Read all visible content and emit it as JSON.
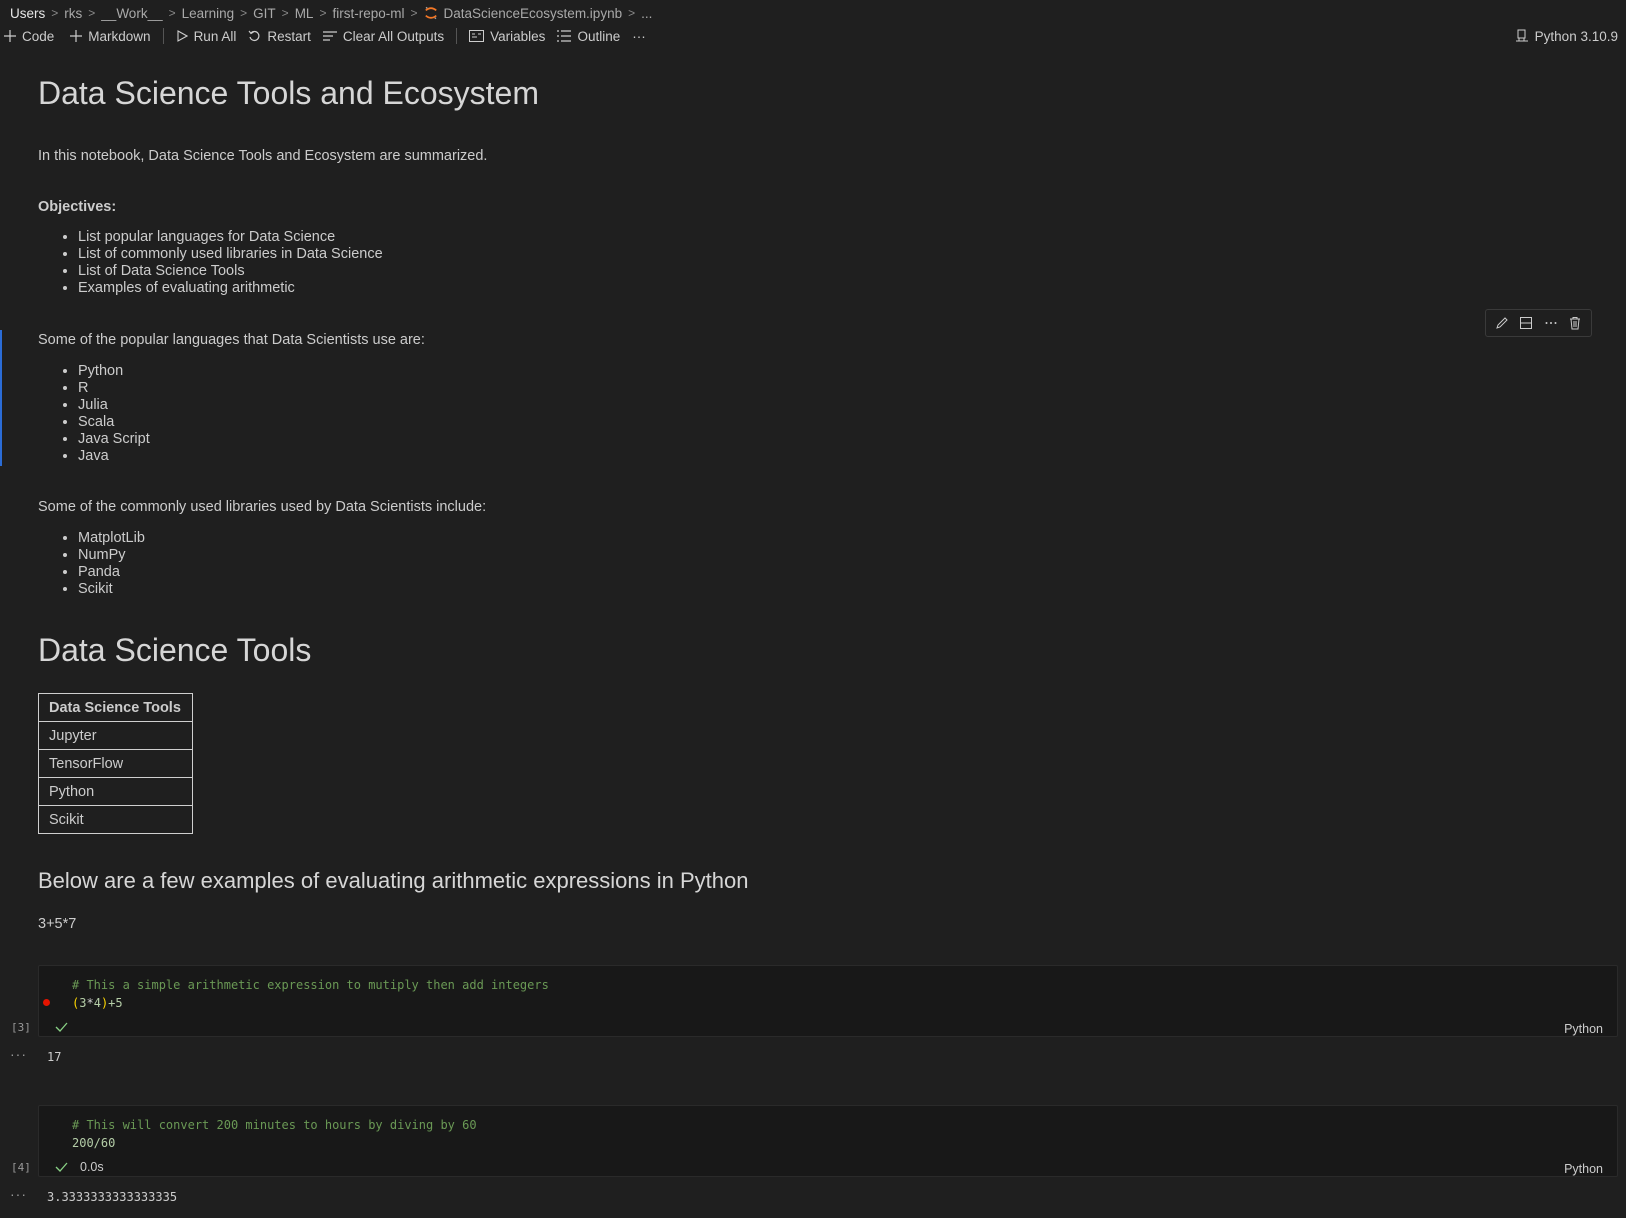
{
  "breadcrumb": {
    "items": [
      "Users",
      "rks",
      "__Work__",
      "Learning",
      "GIT",
      "ML",
      "first-repo-ml"
    ],
    "file": "DataScienceEcosystem.ipynb",
    "more": "..."
  },
  "toolbar": {
    "code": "Code",
    "markdown": "Markdown",
    "run_all": "Run All",
    "restart": "Restart",
    "clear_all": "Clear All Outputs",
    "variables": "Variables",
    "outline": "Outline",
    "more": "···",
    "kernel": "Python 3.10.9"
  },
  "notebook": {
    "title": "Data Science Tools and Ecosystem",
    "intro": "In this notebook, Data Science Tools and Ecosystem are summarized.",
    "objectives_label": "Objectives:",
    "objectives": [
      "List popular languages for Data Science",
      "List of commonly used libraries in Data Science",
      "List of Data Science Tools",
      "Examples of evaluating arithmetic"
    ],
    "languages_intro": "Some of the popular languages that Data Scientists use are:",
    "languages": [
      "Python",
      "R",
      "Julia",
      "Scala",
      "Java Script",
      "Java"
    ],
    "libraries_intro": "Some of the commonly used libraries used by Data Scientists include:",
    "libraries": [
      "MatplotLib",
      "NumPy",
      "Panda",
      "Scikit"
    ],
    "tools_heading": "Data Science Tools",
    "tools_table": {
      "header": "Data Science Tools",
      "rows": [
        "Jupyter",
        "TensorFlow",
        "Python",
        "Scikit"
      ]
    },
    "arith_heading": "Below are a few examples of evaluating arithmetic expressions in Python",
    "arith_example": "3+5*7",
    "cells": [
      {
        "exec_count": "[3]",
        "comment": "# This a simple arithmetic expression to mutiply then add integers",
        "code_parts": [
          "(",
          "3",
          "*",
          "4",
          ")",
          "+5"
        ],
        "duration": "",
        "language": "Python",
        "output": "17"
      },
      {
        "exec_count": "[4]",
        "comment": "# This will convert 200 minutes to hours by diving by 60",
        "code": "200/60",
        "duration": "0.0s",
        "language": "Python",
        "output": "3.3333333333333335"
      }
    ],
    "output_dots": "···"
  },
  "colors": {
    "background": "#1f1f1f",
    "comment": "#6a9955",
    "number": "#b5cea8",
    "accent": "#2b6cd6",
    "breakpoint": "#e51400"
  }
}
